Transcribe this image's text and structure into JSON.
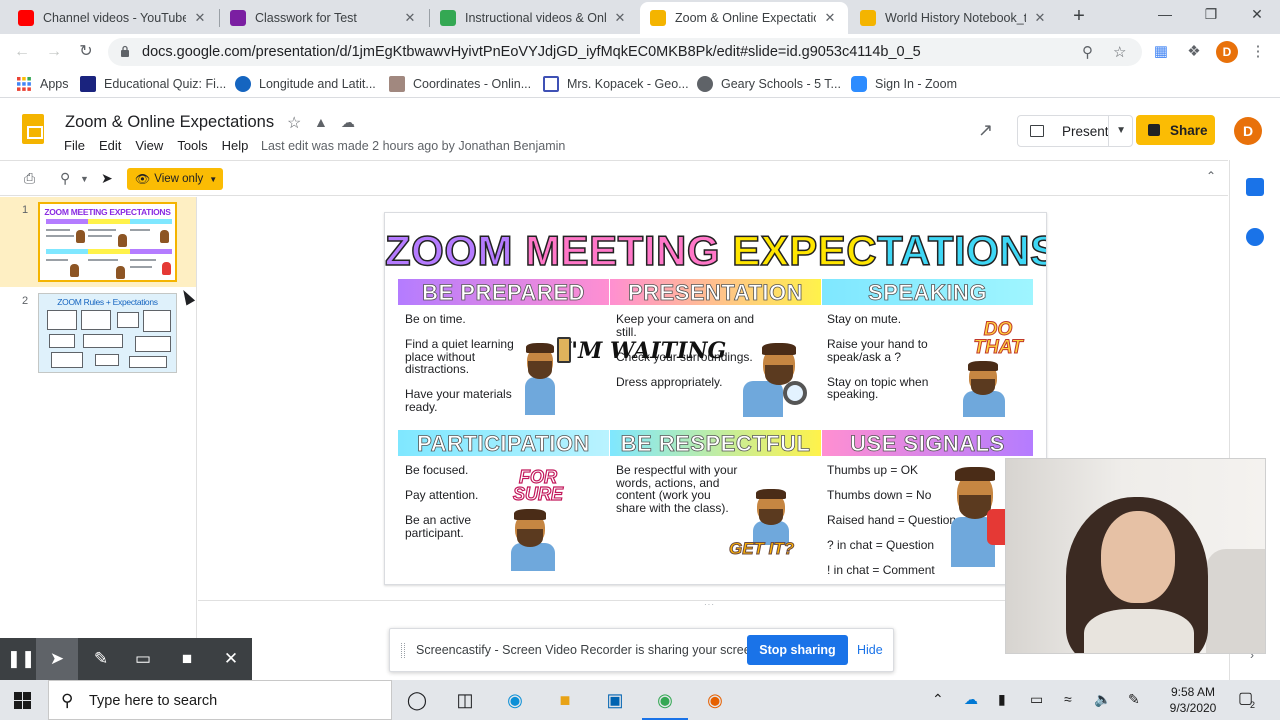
{
  "browser": {
    "tabs": [
      {
        "title": "Channel videos - YouTube Studio",
        "favicon_color": "#ff0000",
        "active": false
      },
      {
        "title": "Classwork for Test",
        "favicon_color": "#7b1fa2",
        "active": false
      },
      {
        "title": "Instructional videos & Online",
        "favicon_color": "#34a853",
        "active": false
      },
      {
        "title": "Zoom & Online Expectations",
        "favicon_color": "#f4b400",
        "active": true
      },
      {
        "title": "World History Notebook_te",
        "favicon_color": "#f4b400",
        "active": false
      }
    ],
    "close_glyph": "✕",
    "new_tab_glyph": "+",
    "window_controls": [
      "—",
      "❐",
      "✕"
    ],
    "url": "docs.google.com/presentation/d/1jmEgKtbwawvHyivtPnEoVYJdjGD_iyfMqkEC0MKB8Pk/edit#slide=id.g9053c4114b_0_5",
    "profile_initial": "D"
  },
  "bookmarks": [
    {
      "label": "Apps",
      "icon_color": "#4285f4"
    },
    {
      "label": "Educational Quiz: Fi...",
      "icon_color": "#1a237e"
    },
    {
      "label": "Longitude and Latit...",
      "icon_color": "#1565c0"
    },
    {
      "label": "Coordinates - Onlin...",
      "icon_color": "#a1887f"
    },
    {
      "label": "Mrs. Kopacek - Geo...",
      "icon_color": "#3f51b5"
    },
    {
      "label": "Geary Schools - 5 T...",
      "icon_color": "#5f6368"
    },
    {
      "label": "Sign In - Zoom",
      "icon_color": "#2d8cff"
    }
  ],
  "doc": {
    "title": "Zoom & Online Expectations",
    "menu": [
      "File",
      "Edit",
      "View",
      "Tools",
      "Help"
    ],
    "last_edit": "Last edit was made 2 hours ago by Jonathan Benjamin",
    "present_label": "Present",
    "share_label": "Share",
    "account_initial": "D",
    "view_only_label": "View only"
  },
  "filmstrip": {
    "slides": [
      {
        "number": "1",
        "thumb_title": "ZOOM MEETING EXPECTATIONS"
      },
      {
        "number": "2",
        "thumb_title": "ZOOM Rules + Expectations"
      }
    ]
  },
  "slide": {
    "title_parts": [
      {
        "text": "ZOOM ",
        "color": "#b57bff"
      },
      {
        "text": "MEETING ",
        "color": "#ff77c8"
      },
      {
        "text": "EXPEC",
        "color": "#ffe600"
      },
      {
        "text": "TATIONS",
        "color": "#3fd7f5"
      }
    ],
    "sections": [
      {
        "heading": "BE PREPARED",
        "band_color": "#b47cff",
        "items": [
          "Be on time.",
          "Find a quiet learning place without distractions.",
          "Have your materials ready."
        ],
        "sticker": "I'M WAITING"
      },
      {
        "heading": "PRESENTATION",
        "band_color": "#fff24a",
        "items": [
          "Keep your camera on and still.",
          "Check your surroundings.",
          "Dress appropriately."
        ],
        "sticker": ""
      },
      {
        "heading": "SPEAKING",
        "band_color": "#7fe7ff",
        "items": [
          "Stay on mute.",
          "Raise your hand to speak/ask a ?",
          "Stay on topic when speaking."
        ],
        "sticker": "DO THAT"
      },
      {
        "heading": "PARTICIPATION",
        "band_color": "#7fe7ff",
        "items": [
          "Be focused.",
          "Pay attention.",
          "Be an active participant."
        ],
        "sticker": "FOR SURE"
      },
      {
        "heading": "BE RESPECTFUL",
        "band_color": "#fff24a",
        "items": [
          "Be respectful with your words, actions, and content (work you share with the class)."
        ],
        "sticker": "GET IT?"
      },
      {
        "heading": "USE SIGNALS",
        "band_color": "#b47cff",
        "items": [
          "Thumbs up = OK",
          "Thumbs down = No",
          "Raised hand = Question",
          "? in chat = Question",
          "! in chat = Comment"
        ],
        "sticker": ""
      }
    ]
  },
  "screencastify": {
    "message": "Screencastify - Screen Video Recorder is sharing your screen.",
    "stop_label": "Stop sharing",
    "hide_label": "Hide"
  },
  "taskbar": {
    "search_placeholder": "Type here to search",
    "time": "9:58 AM",
    "date": "9/3/2020",
    "notification_count": "2"
  }
}
